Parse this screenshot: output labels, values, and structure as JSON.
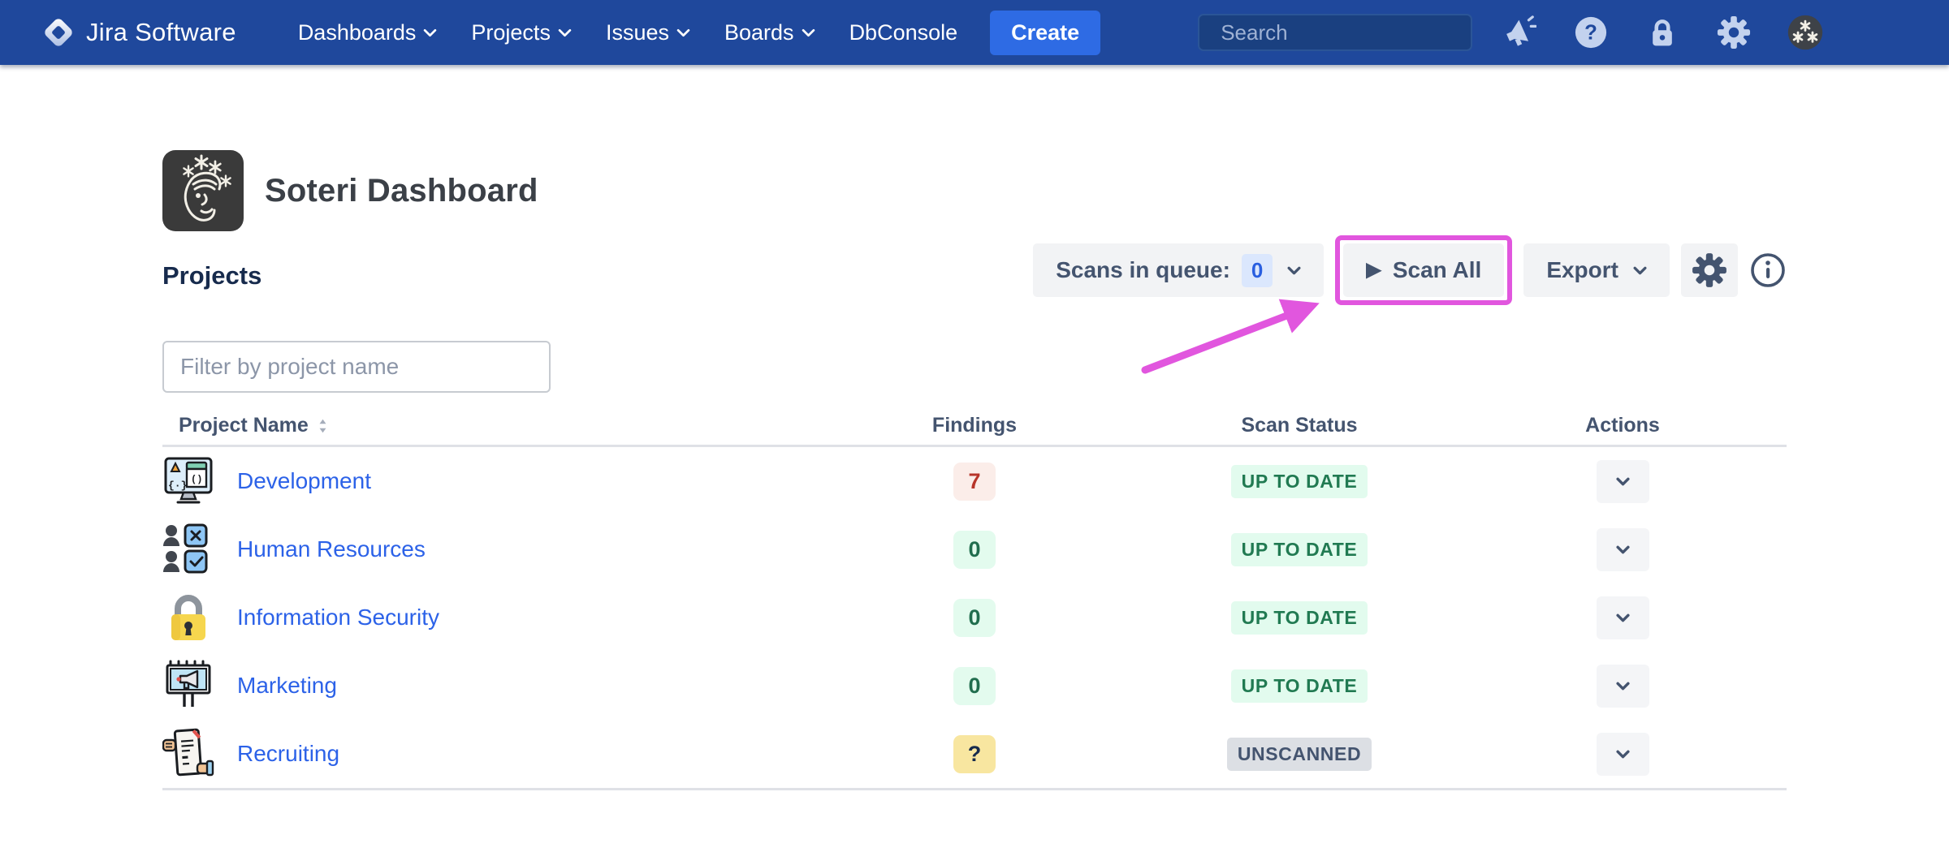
{
  "navbar": {
    "brand": "Jira Software",
    "items": [
      {
        "label": "Dashboards"
      },
      {
        "label": "Projects"
      },
      {
        "label": "Issues"
      },
      {
        "label": "Boards"
      },
      {
        "label": "DbConsole"
      }
    ],
    "create_label": "Create",
    "search_placeholder": "Search",
    "icon_names": [
      "announcement-icon",
      "help-icon",
      "lock-icon",
      "gear-icon",
      "user-avatar"
    ]
  },
  "page": {
    "title": "Soteri Dashboard",
    "section_heading": "Projects",
    "filter_placeholder": "Filter by project name"
  },
  "toolbar": {
    "scans_in_queue_label": "Scans in queue:",
    "scans_in_queue_count": "0",
    "scan_all_label": "Scan All",
    "export_label": "Export"
  },
  "icons": {
    "play": "▶",
    "help_glyph": "?"
  },
  "table": {
    "columns": [
      "Project Name",
      "Findings",
      "Scan Status",
      "Actions"
    ],
    "rows": [
      {
        "name": "Development",
        "icon": "development-monitor-icon",
        "findings": "7",
        "status": "UP TO DATE"
      },
      {
        "name": "Human Resources",
        "icon": "hr-people-checklist-icon",
        "findings": "0",
        "status": "UP TO DATE"
      },
      {
        "name": "Information Security",
        "icon": "padlock-icon",
        "findings": "0",
        "status": "UP TO DATE"
      },
      {
        "name": "Marketing",
        "icon": "billboard-megaphone-icon",
        "findings": "0",
        "status": "UP TO DATE"
      },
      {
        "name": "Recruiting",
        "icon": "resume-hands-icon",
        "findings": "?",
        "status": "UNSCANNED"
      }
    ]
  },
  "annotation": {
    "highlight_target": "Scan All",
    "color": "#E156DE"
  },
  "colors": {
    "navbar_blue": "#1F489C",
    "create_blue": "#2E6BE4",
    "link_blue": "#2C62E8",
    "slate_text": "#44546F",
    "heading_navy": "#172B4D",
    "badge_red_bg": "#FBEDE9",
    "badge_red_text": "#B7352A",
    "badge_green_bg": "#E2FBEE",
    "badge_green_text": "#217A52",
    "badge_yellow_bg": "#F8E6A0",
    "badge_gray_bg": "#DCDFE4",
    "annotation_magenta": "#E156DE"
  }
}
